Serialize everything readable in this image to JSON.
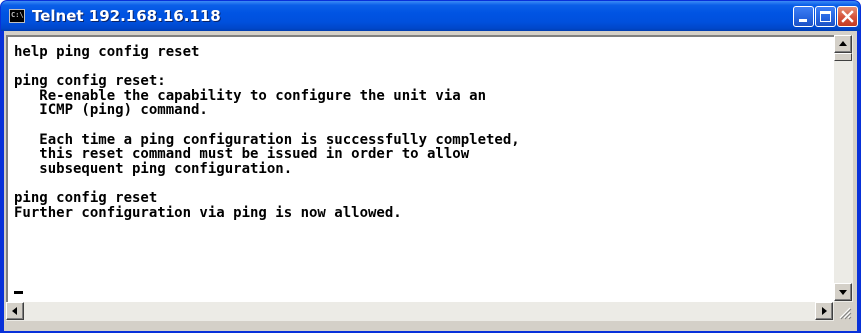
{
  "window": {
    "title": "Telnet 192.168.16.118",
    "icon": "console-window-icon",
    "icon_text": "C:\\"
  },
  "controls": {
    "minimize_icon": "minimize-icon",
    "maximize_icon": "maximize-icon",
    "close_icon": "close-icon"
  },
  "terminal": {
    "lines": [
      "help ping config reset",
      "",
      "ping config reset:",
      "   Re-enable the capability to configure the unit via an",
      "   ICMP (ping) command.",
      "",
      "   Each time a ping configuration is successfully completed,",
      "   this reset command must be issued in order to allow",
      "   subsequent ping configuration.",
      "",
      "ping config reset",
      "Further configuration via ping is now allowed.",
      ""
    ]
  },
  "scrollbars": {
    "up_icon": "arrow-up-icon",
    "down_icon": "arrow-down-icon",
    "left_icon": "arrow-left-icon",
    "right_icon": "arrow-right-icon",
    "grip_icon": "resize-grip-icon"
  },
  "colors": {
    "titlebar": "#0054e3",
    "console_bg": "#ffffff",
    "console_text": "#000000",
    "chrome": "#d4d0c8"
  }
}
